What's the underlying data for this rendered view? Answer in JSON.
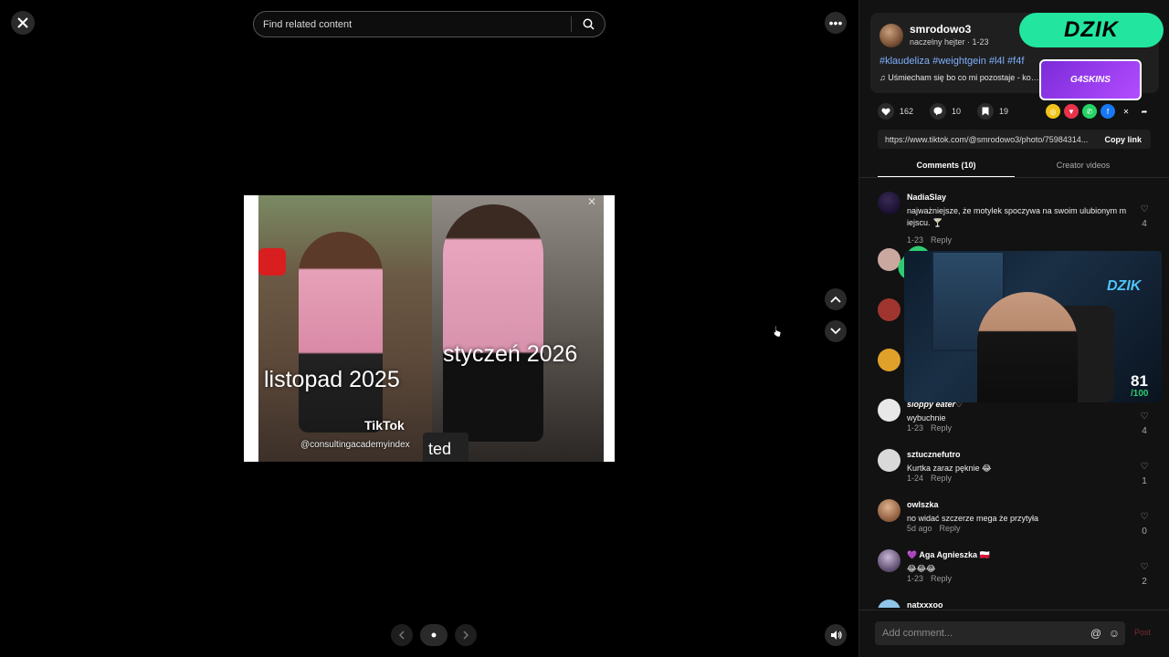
{
  "viewer": {
    "search_placeholder": "Find related content",
    "caption_left": "listopad 2025",
    "caption_right": "styczeń 2026",
    "watermark": "TikTok",
    "watermark_handle": "@consultingacademyindex",
    "partial_text": "ted"
  },
  "post": {
    "username": "smrodowo3",
    "subtitle": "naczelny hejter · 1-23",
    "hashtags": "#klaudeliza #weightgein #l4l #f4f",
    "music": "♫  Uśmiecham się bo co mi pozostaje - ko…",
    "likes": "162",
    "comments": "10",
    "saves": "19",
    "link": "https://www.tiktok.com/@smrodowo3/photo/75984314...",
    "copy_label": "Copy link"
  },
  "tabs": {
    "comments_label": "Comments (10)",
    "creator_label": "Creator videos"
  },
  "comments": [
    {
      "name": "NadiaSlay",
      "text": "najważniejsze, że motylek spoczywa na swoim ulubionym m iejscu. 🍸",
      "date": "1-23",
      "reply": "Reply",
      "likes": "4"
    },
    {
      "name": "sloppy eater♡",
      "text": "wybuchnie",
      "date": "1-23",
      "reply": "Reply",
      "likes": "4"
    },
    {
      "name": "sztucznefutro",
      "text": "Kurtka zaraz pęknie 😂",
      "date": "1-24",
      "reply": "Reply",
      "likes": "1"
    },
    {
      "name": "owlszka",
      "text": "no widać szczerze mega że przytyła",
      "date": "5d ago",
      "reply": "Reply",
      "likes": "0"
    },
    {
      "name": "💜 Aga Agnieszka 🇵🇱",
      "text": "😂😂😂",
      "date": "1-23",
      "reply": "Reply",
      "likes": "2"
    },
    {
      "name": "natxxxoo",
      "text": "",
      "date": "",
      "reply": "",
      "likes": ""
    }
  ],
  "overlay": {
    "dzik_label": "DZIK",
    "skins_label": "G4SKINS",
    "cam_logo": "DZIK",
    "score": "81",
    "score_max": "/100"
  },
  "composer": {
    "placeholder": "Add comment...",
    "at_icon": "@",
    "post_label": "Post"
  },
  "colors": {
    "accent_link": "#7fb0ff",
    "dzik_green": "#22e6a0",
    "skins_purple": "#9b3cf0"
  }
}
